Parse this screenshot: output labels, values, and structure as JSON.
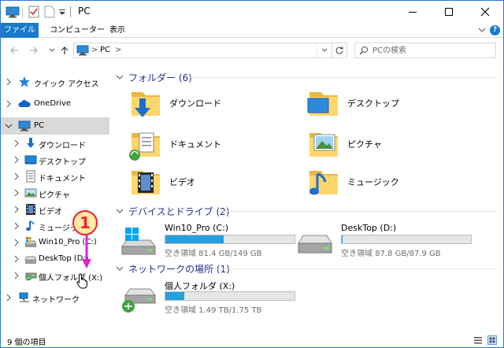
{
  "window": {
    "title": "PC"
  },
  "ribbon": {
    "tabs": [
      "ファイル",
      "コンピューター",
      "表示"
    ]
  },
  "address": {
    "path_root": "PC",
    "path_sep": ">",
    "sep2": ">"
  },
  "search": {
    "placeholder": "PCの検索"
  },
  "nav": {
    "items": [
      {
        "label": "クイック アクセス"
      },
      {
        "label": "OneDrive"
      },
      {
        "label": "PC"
      },
      {
        "label": "ダウンロード"
      },
      {
        "label": "デスクトップ"
      },
      {
        "label": "ドキュメント"
      },
      {
        "label": "ピクチャ"
      },
      {
        "label": "ビデオ"
      },
      {
        "label": "ミュージック"
      },
      {
        "label": "Win10_Pro (C:)"
      },
      {
        "label": "DeskTop (D:)"
      },
      {
        "label": "個人フォルダ (X:)"
      },
      {
        "label": "ネットワーク"
      }
    ]
  },
  "groups": {
    "folders": {
      "title": "フォルダー (6)"
    },
    "drives": {
      "title": "デバイスとドライブ (2)"
    },
    "network": {
      "title": "ネットワークの場所 (1)"
    }
  },
  "folders": [
    {
      "label": "ダウンロード",
      "icon": "download-folder-icon"
    },
    {
      "label": "デスクトップ",
      "icon": "desktop-folder-icon"
    },
    {
      "label": "ドキュメント",
      "icon": "documents-folder-icon"
    },
    {
      "label": "ピクチャ",
      "icon": "pictures-folder-icon"
    },
    {
      "label": "ビデオ",
      "icon": "videos-folder-icon"
    },
    {
      "label": "ミュージック",
      "icon": "music-folder-icon"
    }
  ],
  "drives": [
    {
      "name": "Win10_Pro (C:)",
      "free": "空き領域 81.4 GB/149 GB",
      "used_fraction": 0.454
    },
    {
      "name": "DeskTop (D:)",
      "free": "空き領域 87.8 GB/87.9 GB",
      "used_fraction": 0.002
    }
  ],
  "network_drives": [
    {
      "name": "個人フォルダ (X:)",
      "free": "空き領域 1.49 TB/1.75 TB",
      "used_fraction": 0.148
    }
  ],
  "status": {
    "count": "9 個の項目"
  },
  "annotation": {
    "number": "1"
  },
  "colors": {
    "accent": "#1979ca",
    "group_title": "#1e3287",
    "drive_fill": "#26a0da",
    "selected_bg": "#d9d9d9",
    "annotation_red": "#e22233",
    "annotation_magenta": "#e020d0"
  }
}
